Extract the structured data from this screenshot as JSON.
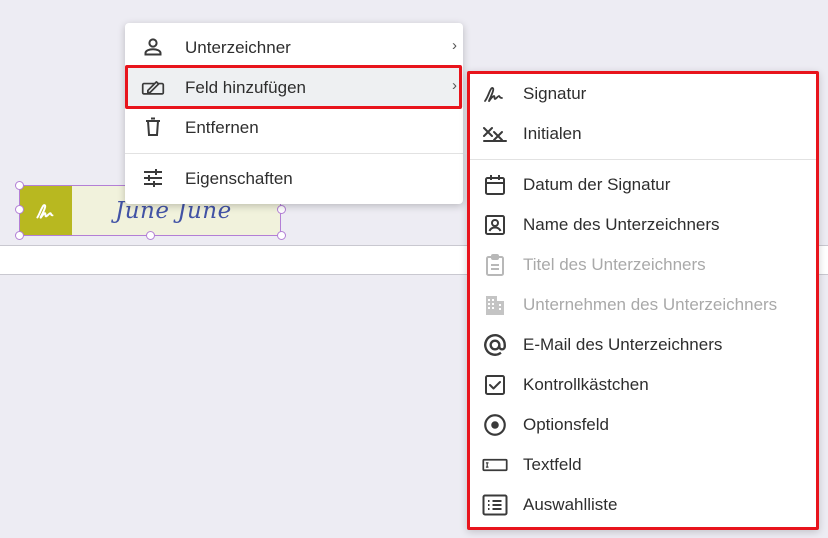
{
  "document": {
    "signature_text": "June  June",
    "signature_badge_icon": "signature-icon",
    "field_color": "#b8b820"
  },
  "context_menu": {
    "items": [
      {
        "label": "Unterzeichner",
        "icon": "person-icon",
        "has_submenu": true
      },
      {
        "label": "Feld hinzufügen",
        "icon": "add-field-icon",
        "has_submenu": true,
        "active": true
      },
      {
        "label": "Entfernen",
        "icon": "trash-icon",
        "has_submenu": false
      },
      {
        "label": "Eigenschaften",
        "icon": "sliders-icon",
        "has_submenu": false
      }
    ],
    "chevron": "›"
  },
  "field_submenu": {
    "items": [
      {
        "label": "Signatur",
        "icon": "signature-icon",
        "enabled": true
      },
      {
        "label": "Initialen",
        "icon": "initials-icon",
        "enabled": true
      },
      {
        "label": "Datum der Signatur",
        "icon": "calendar-icon",
        "enabled": true
      },
      {
        "label": "Name des Unterzeichners",
        "icon": "name-badge-icon",
        "enabled": true
      },
      {
        "label": "Titel des Unterzeichners",
        "icon": "clipboard-icon",
        "enabled": false
      },
      {
        "label": "Unternehmen des Unterzeichners",
        "icon": "building-icon",
        "enabled": false
      },
      {
        "label": "E-Mail des Unterzeichners",
        "icon": "at-icon",
        "enabled": true
      },
      {
        "label": "Kontrollkästchen",
        "icon": "checkbox-icon",
        "enabled": true
      },
      {
        "label": "Optionsfeld",
        "icon": "radio-icon",
        "enabled": true
      },
      {
        "label": "Textfeld",
        "icon": "textfield-icon",
        "enabled": true
      },
      {
        "label": "Auswahlliste",
        "icon": "list-icon",
        "enabled": true
      }
    ]
  },
  "highlight_color": "#e8141c"
}
